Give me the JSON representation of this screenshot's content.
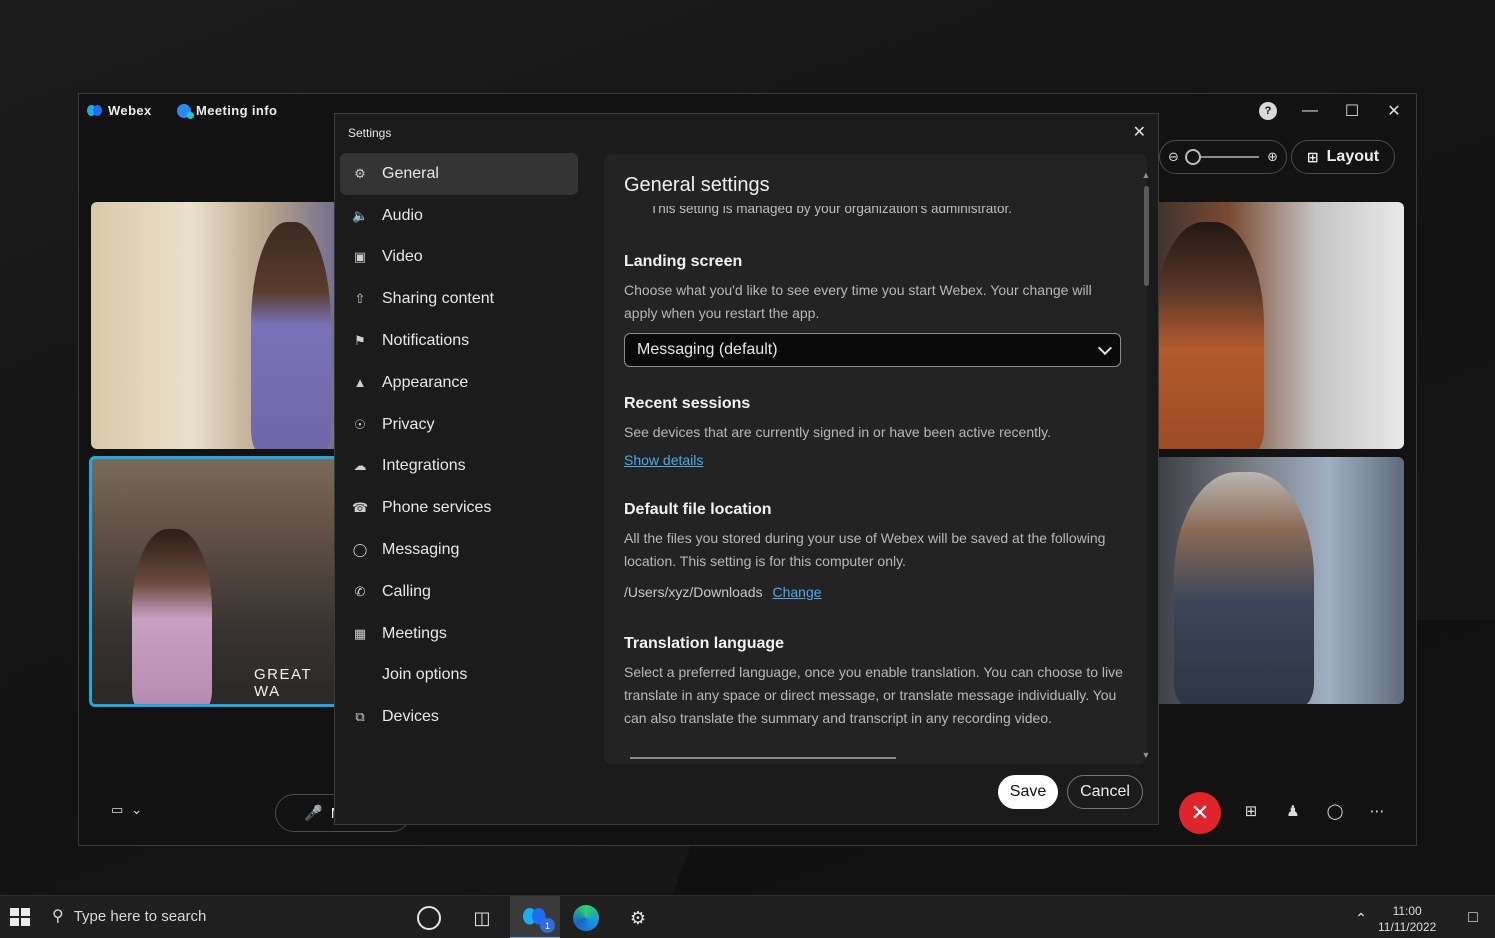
{
  "titlebar": {
    "app_name": "Webex",
    "meeting_info": "Meeting info"
  },
  "toolbar": {
    "layout_label": "Layout"
  },
  "video": {
    "tile2_caption": "GREAT WA"
  },
  "controls": {
    "mute_label": "M"
  },
  "settings": {
    "title": "Settings",
    "nav": [
      {
        "label": "General",
        "icon": "gear-icon"
      },
      {
        "label": "Audio",
        "icon": "speaker-icon"
      },
      {
        "label": "Video",
        "icon": "camera-icon"
      },
      {
        "label": "Sharing content",
        "icon": "share-icon"
      },
      {
        "label": "Notifications",
        "icon": "bell-icon"
      },
      {
        "label": "Appearance",
        "icon": "paint-icon"
      },
      {
        "label": "Privacy",
        "icon": "privacy-icon"
      },
      {
        "label": "Integrations",
        "icon": "cloud-icon"
      },
      {
        "label": "Phone services",
        "icon": "phone-services-icon"
      },
      {
        "label": "Messaging",
        "icon": "chat-icon"
      },
      {
        "label": "Calling",
        "icon": "phone-icon"
      },
      {
        "label": "Meetings",
        "icon": "calendar-icon"
      },
      {
        "label": "Join options",
        "icon": ""
      },
      {
        "label": "Devices",
        "icon": "devices-icon"
      }
    ],
    "panel": {
      "title": "General settings",
      "managed_note": "This setting is managed by your organization's administrator.",
      "landing": {
        "title": "Landing screen",
        "desc": "Choose what you'd like to see every time you start Webex. Your change will apply when you restart the app.",
        "dropdown_value": "Messaging (default)"
      },
      "recent": {
        "title": "Recent sessions",
        "desc": "See devices that are currently signed in or have been active recently.",
        "link": "Show details"
      },
      "file": {
        "title": "Default file location",
        "desc": "All the files you stored during your use of Webex will be saved at the following location. This setting is for this computer only.",
        "path": "/Users/xyz/Downloads",
        "change": "Change"
      },
      "translation": {
        "title": "Translation language",
        "desc": "Select a preferred language, once you enable translation. You can choose to live translate in any space or direct message, or translate message individually. You can also translate the summary and transcript in any recording video."
      }
    },
    "save_label": "Save",
    "cancel_label": "Cancel"
  },
  "taskbar": {
    "search_placeholder": "Type here to search",
    "webex_badge": "1",
    "time": "11:00",
    "date": "11/11/2022"
  }
}
